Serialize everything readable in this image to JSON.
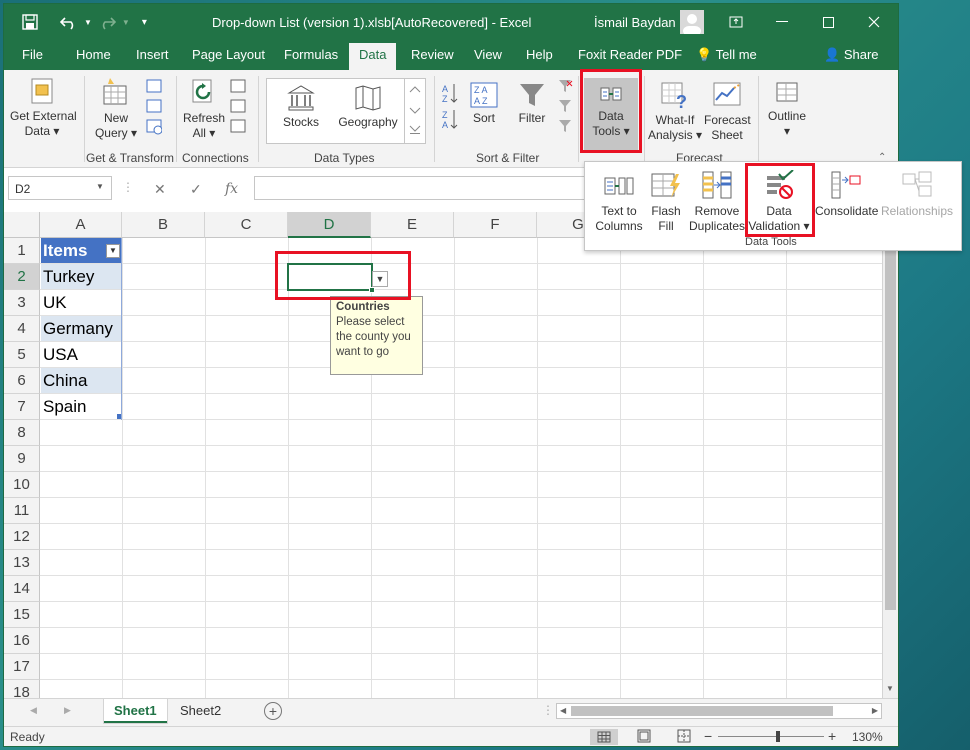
{
  "window": {
    "title": "Drop-down List (version 1).xlsb[AutoRecovered]  -  Excel",
    "user": "İsmail Baydan",
    "controls": {
      "restore": "▣",
      "minimize": "—",
      "maximize": "☐",
      "close": "✕"
    }
  },
  "tabs": [
    "File",
    "Home",
    "Insert",
    "Page Layout",
    "Formulas",
    "Data",
    "Review",
    "View",
    "Help",
    "Foxit Reader PDF",
    "Tell me",
    "Share"
  ],
  "active_tab": "Data",
  "ribbon": {
    "get_external_data": [
      "Get External",
      "Data ▾"
    ],
    "new_query": [
      "New",
      "Query ▾"
    ],
    "refresh_all": [
      "Refresh",
      "All ▾"
    ],
    "stocks": "Stocks",
    "geography": "Geography",
    "sort": "Sort",
    "filter": "Filter",
    "data_tools": [
      "Data",
      "Tools ▾"
    ],
    "what_if": [
      "What-If",
      "Analysis ▾"
    ],
    "forecast_sheet": [
      "Forecast",
      "Sheet"
    ],
    "outline": [
      "Outline",
      "▾"
    ],
    "groups": {
      "get_transform": "Get & Transform",
      "connections": "Connections",
      "data_types": "Data Types",
      "sort_filter": "Sort & Filter",
      "forecast": "Forecast"
    }
  },
  "data_tools_popup": {
    "text_to_columns": [
      "Text to",
      "Columns"
    ],
    "flash_fill": [
      "Flash",
      "Fill"
    ],
    "remove_duplicates": [
      "Remove",
      "Duplicates"
    ],
    "data_validation": [
      "Data",
      "Validation ▾"
    ],
    "consolidate": "Consolidate",
    "relationships": "Relationships",
    "group_label": "Data Tools"
  },
  "formula_bar": {
    "name_box": "D2",
    "fx": "fx",
    "value": ""
  },
  "columns": [
    "A",
    "B",
    "C",
    "D",
    "E",
    "F",
    "G"
  ],
  "rows": [
    "1",
    "2",
    "3",
    "4",
    "5",
    "6",
    "7",
    "8",
    "9",
    "10",
    "11",
    "12",
    "13",
    "14",
    "15",
    "16",
    "17",
    "18"
  ],
  "table": {
    "header": "Items",
    "items": [
      "Turkey",
      "UK",
      "Germany",
      "USA",
      "China",
      "Spain"
    ]
  },
  "input_tooltip": {
    "title": "Countries",
    "message": "Please select the county you want to go"
  },
  "sheets": [
    "Sheet1",
    "Sheet2"
  ],
  "active_sheet": "Sheet1",
  "status": {
    "mode": "Ready",
    "zoom": "130%"
  },
  "colors": {
    "excel_green": "#217346",
    "highlight_red": "#e81123",
    "table_header": "#4472c4",
    "table_band": "#dce6f1"
  }
}
